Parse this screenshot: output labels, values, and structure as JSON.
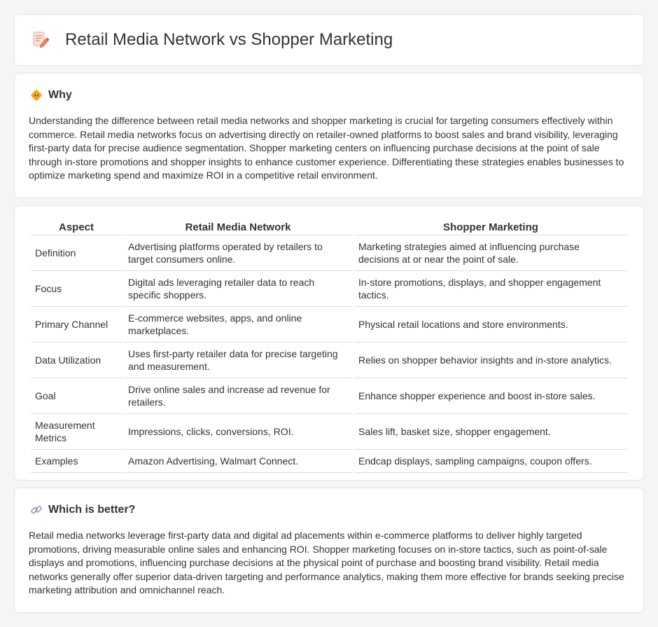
{
  "header": {
    "title": "Retail Media Network vs Shopper Marketing",
    "icon": "document-pencil-icon"
  },
  "why": {
    "title": "Why",
    "icon": "diamond-arrows-icon",
    "text": "Understanding the difference between retail media networks and shopper marketing is crucial for targeting consumers effectively within commerce. Retail media networks focus on advertising directly on retailer-owned platforms to boost sales and brand visibility, leveraging first-party data for precise audience segmentation. Shopper marketing centers on influencing purchase decisions at the point of sale through in-store promotions and shopper insights to enhance customer experience. Differentiating these strategies enables businesses to optimize marketing spend and maximize ROI in a competitive retail environment."
  },
  "table": {
    "headers": [
      "Aspect",
      "Retail Media Network",
      "Shopper Marketing"
    ],
    "rows": [
      [
        "Definition",
        "Advertising platforms operated by retailers to target consumers online.",
        "Marketing strategies aimed at influencing purchase decisions at or near the point of sale."
      ],
      [
        "Focus",
        "Digital ads leveraging retailer data to reach specific shoppers.",
        "In-store promotions, displays, and shopper engagement tactics."
      ],
      [
        "Primary Channel",
        "E-commerce websites, apps, and online marketplaces.",
        "Physical retail locations and store environments."
      ],
      [
        "Data Utilization",
        "Uses first-party retailer data for precise targeting and measurement.",
        "Relies on shopper behavior insights and in-store analytics."
      ],
      [
        "Goal",
        "Drive online sales and increase ad revenue for retailers.",
        "Enhance shopper experience and boost in-store sales."
      ],
      [
        "Measurement Metrics",
        "Impressions, clicks, conversions, ROI.",
        "Sales lift, basket size, shopper engagement."
      ],
      [
        "Examples",
        "Amazon Advertising, Walmart Connect.",
        "Endcap displays, sampling campaigns, coupon offers."
      ]
    ]
  },
  "better": {
    "title": "Which is better?",
    "icon": "link-icon",
    "text": "Retail media networks leverage first-party data and digital ad placements within e-commerce platforms to deliver highly targeted promotions, driving measurable online sales and enhancing ROI. Shopper marketing focuses on in-store tactics, such as point-of-sale displays and promotions, influencing purchase decisions at the physical point of purchase and boosting brand visibility. Retail media networks generally offer superior data-driven targeting and performance analytics, making them more effective for brands seeking precise marketing attribution and omnichannel reach."
  }
}
